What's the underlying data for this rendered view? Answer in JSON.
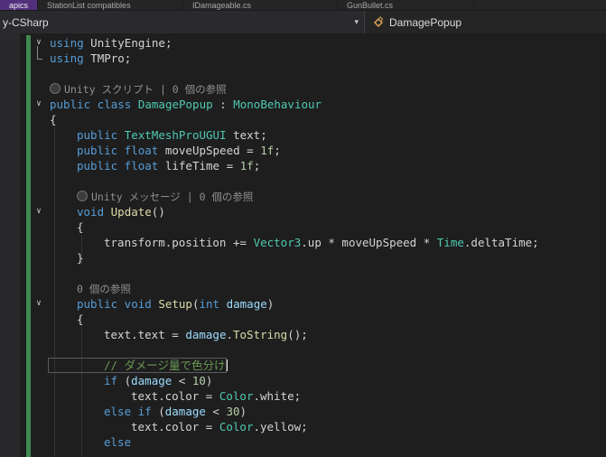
{
  "tab_strip": {
    "tabs": [
      {
        "label": "apics"
      },
      {
        "label": "StationList compatibles"
      },
      {
        "label": "IDamageable.cs"
      },
      {
        "label": "GunBullet.cs"
      }
    ]
  },
  "nav_bar": {
    "project_dropdown": "y-CSharp",
    "dropdown_chevron": "▾",
    "member_dropdown": "DamagePopup"
  },
  "colors": {
    "editor_background": "#1e1e1e",
    "keyword": "#569cd6",
    "type_name": "#4ec9b0",
    "method_name": "#dcdcaa",
    "parameter": "#9cdcfe",
    "number": "#b5cea8",
    "comment": "#6a9955",
    "codelens": "#8f8f8f",
    "change_tracking_bar": "#3f8a4f",
    "active_tab": "#52307c"
  },
  "editor": {
    "lines": [
      {
        "kind": "code",
        "indent": 0,
        "fold": true,
        "tokens": [
          [
            "kw",
            "using"
          ],
          [
            "plain",
            " UnityEngine;"
          ]
        ]
      },
      {
        "kind": "code",
        "indent": 0,
        "tokens": [
          [
            "kw",
            "using"
          ],
          [
            "plain",
            " TMPro;"
          ]
        ]
      },
      {
        "kind": "blank"
      },
      {
        "kind": "lens",
        "indent": 0,
        "icon": true,
        "text": "Unity スクリプト | 0 個の参照"
      },
      {
        "kind": "code",
        "indent": 0,
        "fold": true,
        "tokens": [
          [
            "kw",
            "public class"
          ],
          [
            "plain",
            " "
          ],
          [
            "type",
            "DamagePopup"
          ],
          [
            "plain",
            " : "
          ],
          [
            "type",
            "MonoBehaviour"
          ]
        ]
      },
      {
        "kind": "code",
        "indent": 0,
        "tokens": [
          [
            "plain",
            "{"
          ]
        ]
      },
      {
        "kind": "code",
        "indent": 1,
        "tokens": [
          [
            "kw",
            "public"
          ],
          [
            "plain",
            " "
          ],
          [
            "type",
            "TextMeshProUGUI"
          ],
          [
            "plain",
            " text;"
          ]
        ]
      },
      {
        "kind": "code",
        "indent": 1,
        "tokens": [
          [
            "kw",
            "public float"
          ],
          [
            "plain",
            " moveUpSpeed = "
          ],
          [
            "num",
            "1f"
          ],
          [
            "plain",
            ";"
          ]
        ]
      },
      {
        "kind": "code",
        "indent": 1,
        "tokens": [
          [
            "kw",
            "public float"
          ],
          [
            "plain",
            " lifeTime = "
          ],
          [
            "num",
            "1f"
          ],
          [
            "plain",
            ";"
          ]
        ]
      },
      {
        "kind": "blank"
      },
      {
        "kind": "lens",
        "indent": 1,
        "icon": true,
        "text": "Unity メッセージ | 0 個の参照"
      },
      {
        "kind": "code",
        "indent": 1,
        "fold": true,
        "tokens": [
          [
            "kw",
            "void"
          ],
          [
            "plain",
            " "
          ],
          [
            "method",
            "Update"
          ],
          [
            "plain",
            "()"
          ]
        ]
      },
      {
        "kind": "code",
        "indent": 1,
        "tokens": [
          [
            "plain",
            "{"
          ]
        ]
      },
      {
        "kind": "code",
        "indent": 2,
        "tokens": [
          [
            "plain",
            "transform.position += "
          ],
          [
            "type",
            "Vector3"
          ],
          [
            "plain",
            ".up * moveUpSpeed * "
          ],
          [
            "type",
            "Time"
          ],
          [
            "plain",
            ".deltaTime;"
          ]
        ]
      },
      {
        "kind": "code",
        "indent": 1,
        "tokens": [
          [
            "plain",
            "}"
          ]
        ]
      },
      {
        "kind": "blank"
      },
      {
        "kind": "lens",
        "indent": 1,
        "icon": false,
        "text": "0 個の参照"
      },
      {
        "kind": "code",
        "indent": 1,
        "fold": true,
        "tokens": [
          [
            "kw",
            "public void"
          ],
          [
            "plain",
            " "
          ],
          [
            "method",
            "Setup"
          ],
          [
            "plain",
            "("
          ],
          [
            "kw",
            "int"
          ],
          [
            "plain",
            " "
          ],
          [
            "var",
            "damage"
          ],
          [
            "plain",
            ")"
          ]
        ]
      },
      {
        "kind": "code",
        "indent": 1,
        "tokens": [
          [
            "plain",
            "{"
          ]
        ]
      },
      {
        "kind": "code",
        "indent": 2,
        "tokens": [
          [
            "plain",
            "text.text = "
          ],
          [
            "var",
            "damage"
          ],
          [
            "plain",
            "."
          ],
          [
            "method",
            "ToString"
          ],
          [
            "plain",
            "();"
          ]
        ]
      },
      {
        "kind": "blank"
      },
      {
        "kind": "code",
        "indent": 2,
        "current": true,
        "caret": true,
        "tokens": [
          [
            "comment",
            "// ダメージ量で色分け"
          ]
        ]
      },
      {
        "kind": "code",
        "indent": 2,
        "tokens": [
          [
            "kw",
            "if"
          ],
          [
            "plain",
            " ("
          ],
          [
            "var",
            "damage"
          ],
          [
            "plain",
            " < "
          ],
          [
            "num",
            "10"
          ],
          [
            "plain",
            ")"
          ]
        ]
      },
      {
        "kind": "code",
        "indent": 3,
        "tokens": [
          [
            "plain",
            "text.color = "
          ],
          [
            "type",
            "Color"
          ],
          [
            "plain",
            ".white;"
          ]
        ]
      },
      {
        "kind": "code",
        "indent": 2,
        "tokens": [
          [
            "kw",
            "else if"
          ],
          [
            "plain",
            " ("
          ],
          [
            "var",
            "damage"
          ],
          [
            "plain",
            " < "
          ],
          [
            "num",
            "30"
          ],
          [
            "plain",
            ")"
          ]
        ]
      },
      {
        "kind": "code",
        "indent": 3,
        "tokens": [
          [
            "plain",
            "text.color = "
          ],
          [
            "type",
            "Color"
          ],
          [
            "plain",
            ".yellow;"
          ]
        ]
      },
      {
        "kind": "code",
        "indent": 2,
        "tokens": [
          [
            "kw",
            "else"
          ]
        ]
      }
    ]
  }
}
